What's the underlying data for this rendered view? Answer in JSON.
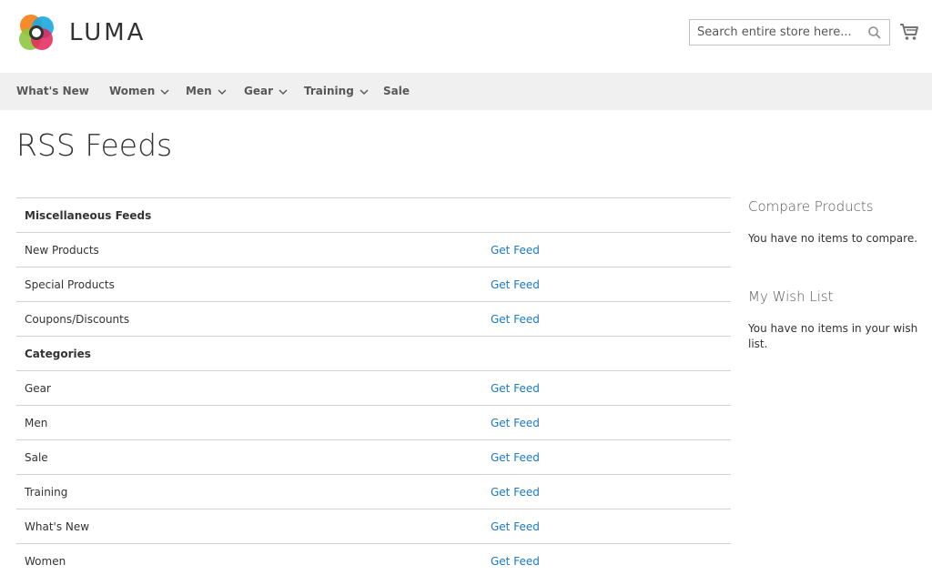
{
  "header": {
    "logo_text": "LUMA",
    "search_placeholder": "Search entire store here..."
  },
  "nav": {
    "items": [
      {
        "label": "What's New",
        "has_dropdown": false
      },
      {
        "label": "Women",
        "has_dropdown": true
      },
      {
        "label": "Men",
        "has_dropdown": true
      },
      {
        "label": "Gear",
        "has_dropdown": true
      },
      {
        "label": "Training",
        "has_dropdown": true
      },
      {
        "label": "Sale",
        "has_dropdown": false
      }
    ]
  },
  "page_title": "RSS Feeds",
  "feeds": {
    "rows": [
      {
        "name": "Miscellaneous Feeds",
        "section": true,
        "link": ""
      },
      {
        "name": "New Products",
        "section": false,
        "link": "Get Feed"
      },
      {
        "name": "Special Products",
        "section": false,
        "link": "Get Feed"
      },
      {
        "name": "Coupons/Discounts",
        "section": false,
        "link": "Get Feed"
      },
      {
        "name": "Categories",
        "section": true,
        "link": ""
      },
      {
        "name": "Gear",
        "section": false,
        "link": "Get Feed"
      },
      {
        "name": "Men",
        "section": false,
        "link": "Get Feed"
      },
      {
        "name": "Sale",
        "section": false,
        "link": "Get Feed"
      },
      {
        "name": "Training",
        "section": false,
        "link": "Get Feed"
      },
      {
        "name": "What's New",
        "section": false,
        "link": "Get Feed"
      },
      {
        "name": "Women",
        "section": false,
        "link": "Get Feed"
      }
    ]
  },
  "sidebar": {
    "compare": {
      "title": "Compare Products",
      "text": "You have no items to compare."
    },
    "wishlist": {
      "title": "My Wish List",
      "text": "You have no items in your wish list."
    }
  },
  "colors": {
    "link": "#1979c3",
    "nav_bg": "#f0f0f0"
  }
}
